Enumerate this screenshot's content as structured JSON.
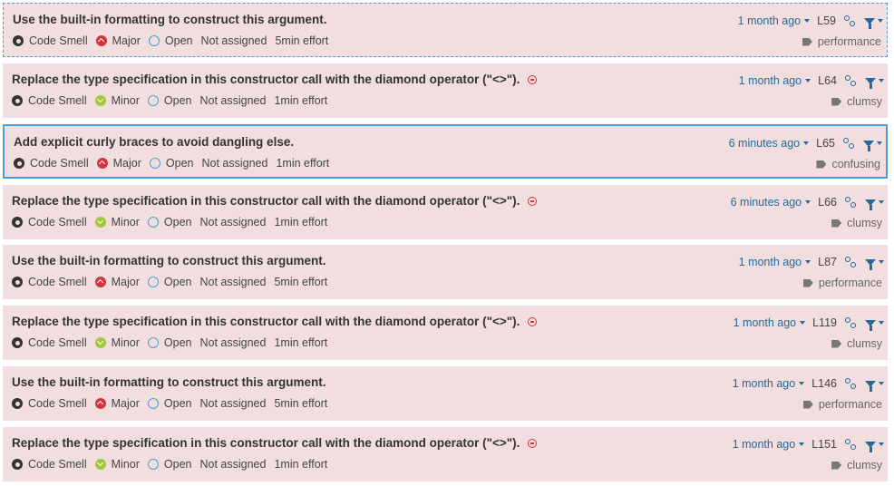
{
  "issues": [
    {
      "message": "Use the built-in formatting to construct this argument.",
      "ext": false,
      "type": "Code Smell",
      "severity": "Major",
      "severity_icon": "major-severity-icon",
      "status": "Open",
      "assignee": "Not assigned",
      "effort": "5min effort",
      "date": "1 month ago",
      "line": "L59",
      "tag": "performance",
      "selected": "dashed"
    },
    {
      "message": "Replace the type specification in this constructor call with the diamond operator (\"<>\").",
      "ext": true,
      "type": "Code Smell",
      "severity": "Minor",
      "severity_icon": "minor-severity-icon",
      "status": "Open",
      "assignee": "Not assigned",
      "effort": "1min effort",
      "date": "1 month ago",
      "line": "L64",
      "tag": "clumsy",
      "selected": ""
    },
    {
      "message": "Add explicit curly braces to avoid dangling else.",
      "ext": false,
      "type": "Code Smell",
      "severity": "Major",
      "severity_icon": "major-severity-icon",
      "status": "Open",
      "assignee": "Not assigned",
      "effort": "1min effort",
      "date": "6 minutes ago",
      "line": "L65",
      "tag": "confusing",
      "selected": "solid"
    },
    {
      "message": "Replace the type specification in this constructor call with the diamond operator (\"<>\").",
      "ext": true,
      "type": "Code Smell",
      "severity": "Minor",
      "severity_icon": "minor-severity-icon",
      "status": "Open",
      "assignee": "Not assigned",
      "effort": "1min effort",
      "date": "6 minutes ago",
      "line": "L66",
      "tag": "clumsy",
      "selected": ""
    },
    {
      "message": "Use the built-in formatting to construct this argument.",
      "ext": false,
      "type": "Code Smell",
      "severity": "Major",
      "severity_icon": "major-severity-icon",
      "status": "Open",
      "assignee": "Not assigned",
      "effort": "5min effort",
      "date": "1 month ago",
      "line": "L87",
      "tag": "performance",
      "selected": ""
    },
    {
      "message": "Replace the type specification in this constructor call with the diamond operator (\"<>\").",
      "ext": true,
      "type": "Code Smell",
      "severity": "Minor",
      "severity_icon": "minor-severity-icon",
      "status": "Open",
      "assignee": "Not assigned",
      "effort": "1min effort",
      "date": "1 month ago",
      "line": "L119",
      "tag": "clumsy",
      "selected": ""
    },
    {
      "message": "Use the built-in formatting to construct this argument.",
      "ext": false,
      "type": "Code Smell",
      "severity": "Major",
      "severity_icon": "major-severity-icon",
      "status": "Open",
      "assignee": "Not assigned",
      "effort": "5min effort",
      "date": "1 month ago",
      "line": "L146",
      "tag": "performance",
      "selected": ""
    },
    {
      "message": "Replace the type specification in this constructor call with the diamond operator (\"<>\").",
      "ext": true,
      "type": "Code Smell",
      "severity": "Minor",
      "severity_icon": "minor-severity-icon",
      "status": "Open",
      "assignee": "Not assigned",
      "effort": "1min effort",
      "date": "1 month ago",
      "line": "L151",
      "tag": "clumsy",
      "selected": ""
    }
  ],
  "colors": {
    "row_bg": "#f2dede",
    "accent": "#236a97",
    "selection": "#4b9fd5",
    "major": "#d4333f",
    "minor": "#a4c639"
  }
}
